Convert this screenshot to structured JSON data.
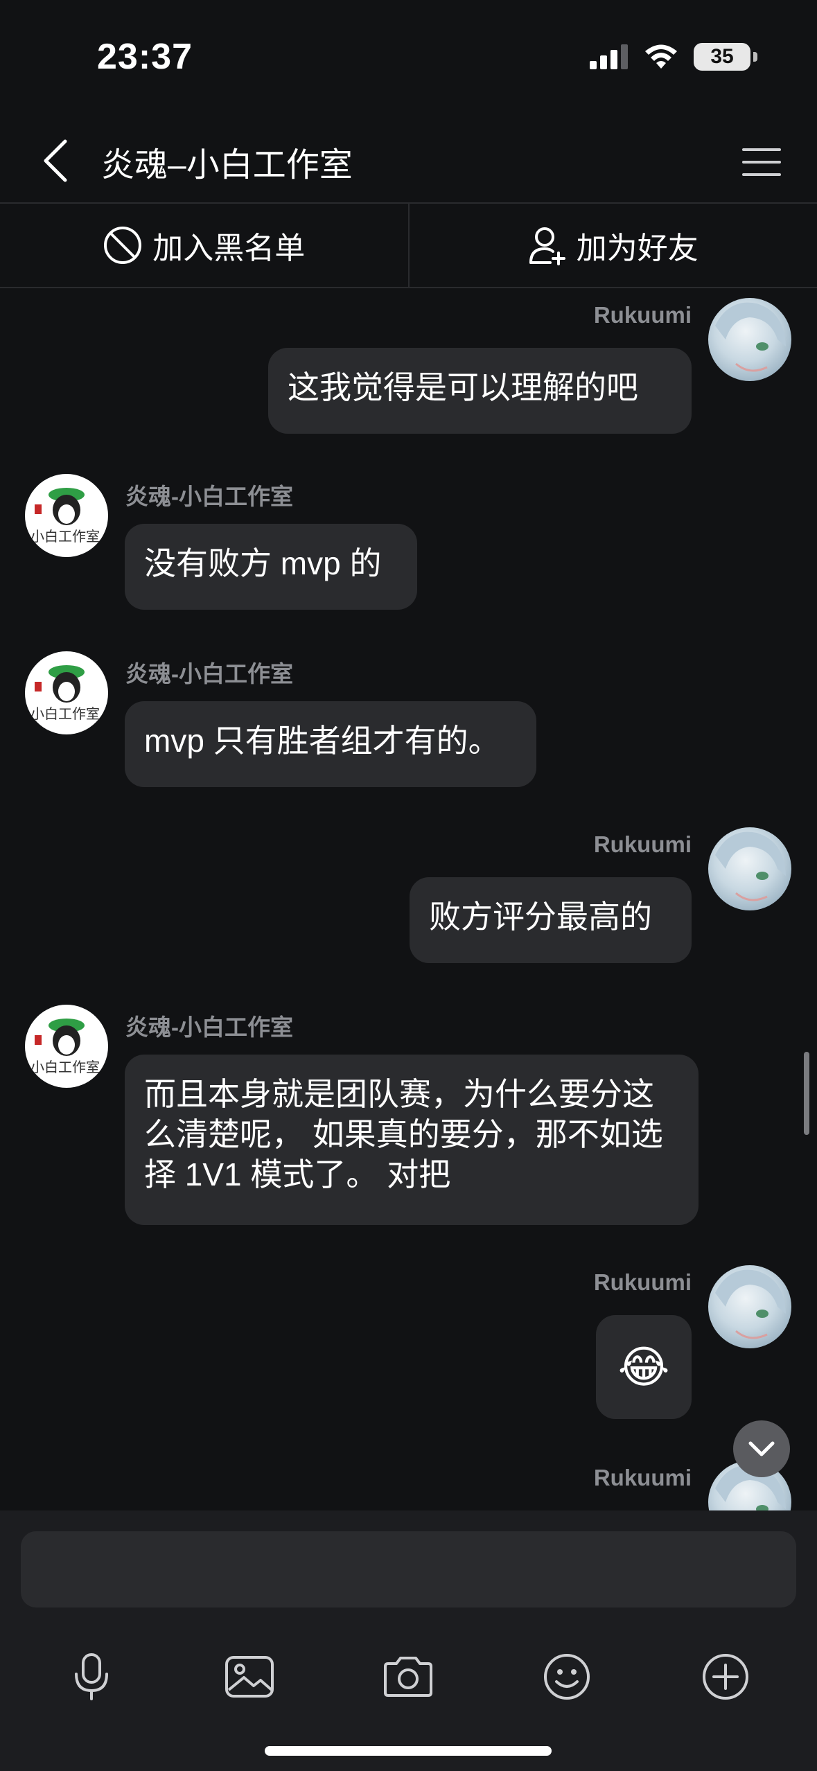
{
  "status_bar": {
    "time": "23:37",
    "battery": "35"
  },
  "header": {
    "title": "炎魂–小白工作室"
  },
  "actions": {
    "block": "加入黑名单",
    "add_friend": "加为好友"
  },
  "messages": [
    {
      "side": "right",
      "sender": "Rukuumi",
      "text": "这我觉得是可以理解的吧"
    },
    {
      "side": "left",
      "sender": "炎魂-小白工作室",
      "text": "没有败方 mvp 的"
    },
    {
      "side": "left",
      "sender": "炎魂-小白工作室",
      "text": "mvp 只有胜者组才有的。"
    },
    {
      "side": "right",
      "sender": "Rukuumi",
      "text": "败方评分最高的"
    },
    {
      "side": "left",
      "sender": "炎魂-小白工作室",
      "text": "而且本身就是团队赛，为什么要分这么清楚呢， 如果真的要分，那不如选择 1V1 模式了。 对把"
    },
    {
      "side": "right",
      "sender": "Rukuumi",
      "text": "😂"
    },
    {
      "side": "right",
      "sender": "Rukuumi",
      "text": ""
    }
  ],
  "left_avatar_text": "小白工作室",
  "composer": {
    "placeholder": ""
  },
  "toolbar": [
    "microphone-icon",
    "image-icon",
    "camera-icon",
    "emoji-icon",
    "plus-circle-icon"
  ]
}
